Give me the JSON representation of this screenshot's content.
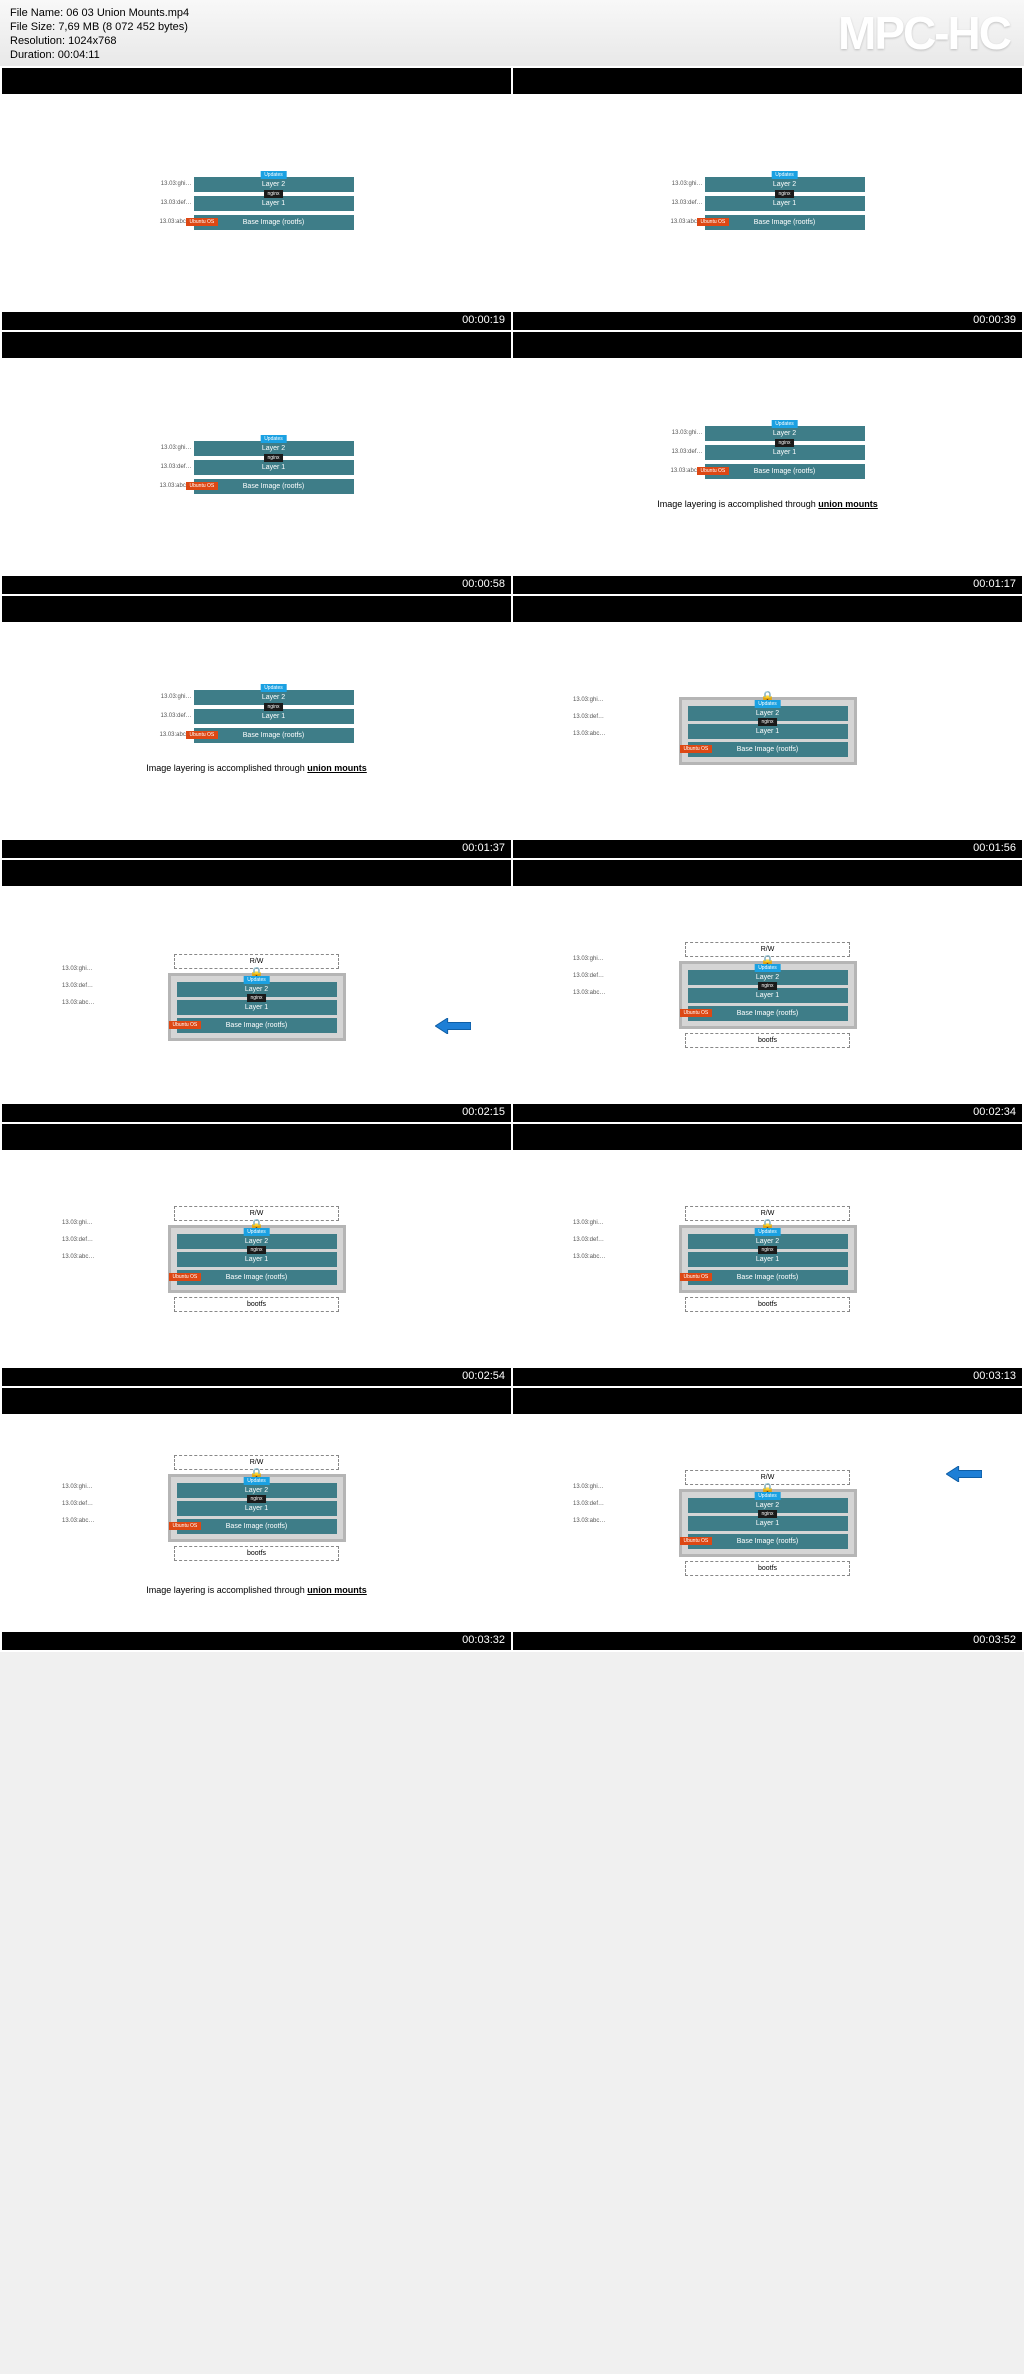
{
  "header": {
    "filename_label": "File Name:",
    "filename": "06 03 Union Mounts.mp4",
    "filesize_label": "File Size:",
    "filesize": "7,69 MB (8 072 452 bytes)",
    "resolution_label": "Resolution:",
    "resolution": "1024x768",
    "duration_label": "Duration:",
    "duration": "00:04:11",
    "logo": "MPC-HC"
  },
  "labels": {
    "l1": "13.03:abc…",
    "l2": "13.03:def…",
    "l3": "13.03:ghi…"
  },
  "tags": {
    "updates": "Updates",
    "nginx": "nginx",
    "ubuntu": "Ubuntu OS"
  },
  "layers": {
    "layer2": "Layer 2",
    "layer1": "Layer 1",
    "base": "Base Image  (rootfs)"
  },
  "caption": {
    "pre": "Image layering is accomplished through ",
    "em": "union mounts"
  },
  "extra": {
    "rw": "R/W",
    "bootfs": "bootfs"
  },
  "timestamps": [
    "00:00:19",
    "00:00:39",
    "00:00:58",
    "00:01:17",
    "00:01:37",
    "00:01:56",
    "00:02:15",
    "00:02:34",
    "00:02:54",
    "00:03:13",
    "00:03:32",
    "00:03:52"
  ]
}
